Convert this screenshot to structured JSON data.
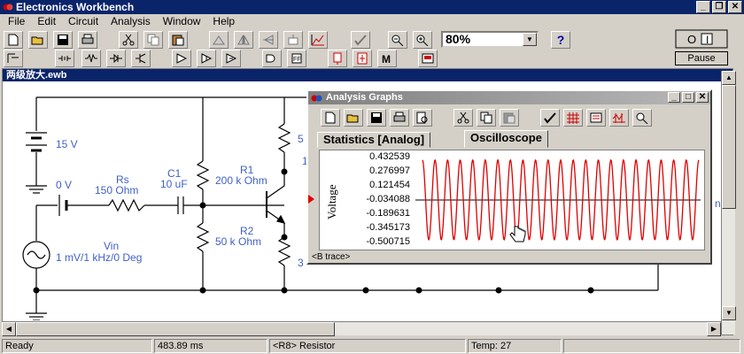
{
  "app": {
    "title": "Electronics Workbench",
    "window_buttons": [
      "_",
      "❐",
      "✕"
    ]
  },
  "menu": [
    "File",
    "Edit",
    "Circuit",
    "Analysis",
    "Window",
    "Help"
  ],
  "toolbar": {
    "zoom_value": "80%",
    "help_label": "?",
    "pause_label": "Pause"
  },
  "circuit_window": {
    "title": "两级放大.ewb",
    "components": {
      "battery_label": "15 V",
      "vin_source_value": "0 V",
      "rs_name": "Rs",
      "rs_value": "150 Ohm",
      "c1_name": "C1",
      "c1_value": "10 uF",
      "r1_name": "R1",
      "r1_value": "200 k Ohm",
      "r2_name": "R2",
      "r2_value": "50 k Ohm",
      "vin_name": "Vin",
      "vin_value": "1 mV/1 kHz/0 Deg",
      "partial_5": "5",
      "partial_1": "1",
      "partial_3": "3",
      "partial_n": "n"
    }
  },
  "analysis_graphs": {
    "title": "Analysis Graphs",
    "tabs": [
      "Statistics [Analog]",
      "Oscilloscope"
    ],
    "active_tab": "Oscilloscope",
    "ylabel": "Voltage",
    "trace_label": "<B trace>",
    "trace_color": "#e00000",
    "chart_data": {
      "type": "line",
      "ylabel": "Voltage",
      "yticks": [
        0.432539,
        0.276997,
        0.121454,
        -0.034088,
        -0.189631,
        -0.345173,
        -0.500715
      ],
      "ylim": [
        -0.500715,
        0.432539
      ],
      "cycles": 22,
      "amplitude_max": 0.405,
      "amplitude_min": -0.47,
      "offset": -0.034088
    }
  },
  "status": {
    "state": "Ready",
    "time": "483.89 ms",
    "component": "<R8> Resistor",
    "temp": "Temp:  27"
  }
}
